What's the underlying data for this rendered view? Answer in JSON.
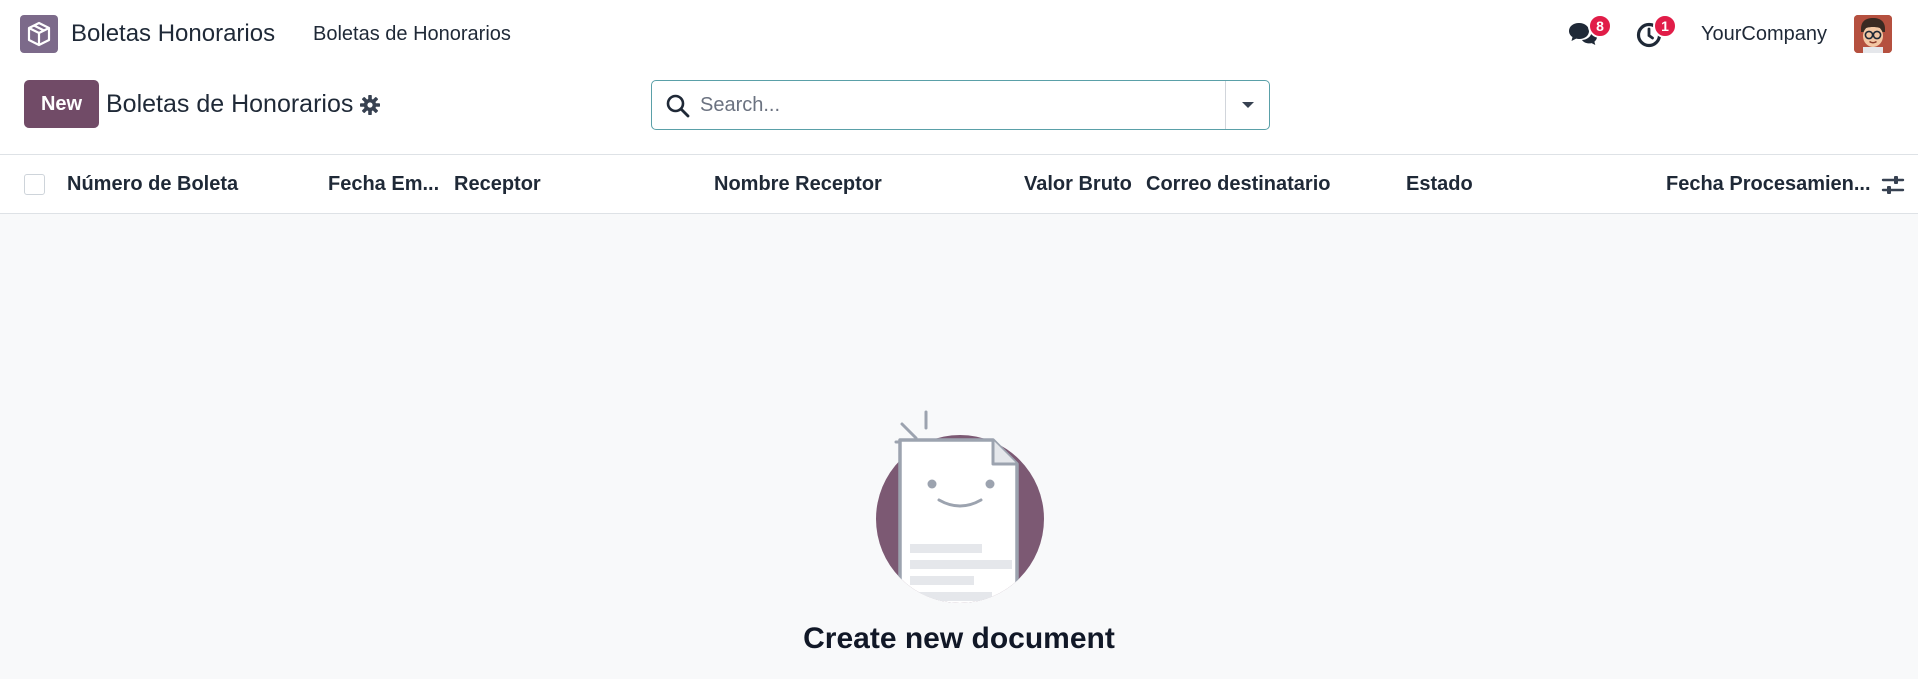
{
  "navbar": {
    "app_name": "Boletas Honorarios",
    "menu_item": "Boletas de Honorarios",
    "messages_badge": "8",
    "activities_badge": "1",
    "company": "YourCompany"
  },
  "control_panel": {
    "new_label": "New",
    "title": "Boletas de Honorarios",
    "search_placeholder": "Search..."
  },
  "table": {
    "columns": [
      "Número de Boleta",
      "Fecha Em...",
      "Receptor",
      "Nombre Receptor",
      "Valor Bruto",
      "Correo destinatario",
      "Estado",
      "Fecha Procesamien..."
    ]
  },
  "empty_state": {
    "title": "Create new document"
  },
  "colors": {
    "brand": "#714b67",
    "badge": "#e11d48",
    "search_border": "#5aa0a8"
  },
  "icons": [
    "app-box-icon",
    "chat-bubbles-icon",
    "clock-icon",
    "gear-icon",
    "search-icon",
    "caret-down-icon",
    "sliders-icon",
    "document-smiley-icon"
  ]
}
